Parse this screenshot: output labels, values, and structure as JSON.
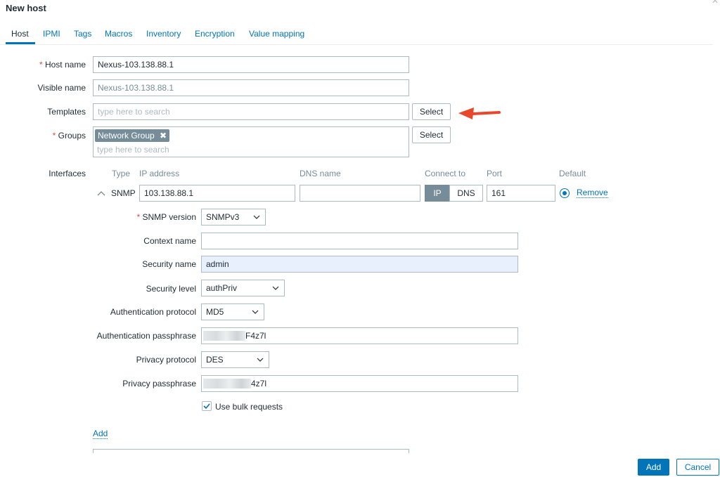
{
  "dialog": {
    "title": "New host"
  },
  "tabs": [
    "Host",
    "IPMI",
    "Tags",
    "Macros",
    "Inventory",
    "Encryption",
    "Value mapping"
  ],
  "form": {
    "host_name": {
      "label": "Host name",
      "required_mark": "*",
      "value": "Nexus-103.138.88.1"
    },
    "visible_name": {
      "label": "Visible name",
      "value": "Nexus-103.138.88.1"
    },
    "templates": {
      "label": "Templates",
      "placeholder": "type here to search",
      "select_label": "Select"
    },
    "groups": {
      "label": "Groups",
      "required_mark": "*",
      "chip": "Network Group",
      "placeholder": "type here to search",
      "select_label": "Select"
    },
    "interfaces": {
      "label": "Interfaces",
      "headers": {
        "type": "Type",
        "ip": "IP address",
        "dns": "DNS name",
        "connect_to": "Connect to",
        "port": "Port",
        "default": "Default"
      },
      "row": {
        "type": "SNMP",
        "ip": "103.138.88.1",
        "dns": "",
        "connect_ip": "IP",
        "connect_dns": "DNS",
        "port": "161",
        "remove": "Remove"
      },
      "add_link": "Add"
    },
    "snmp": {
      "version": {
        "label": "SNMP version",
        "required_mark": "*",
        "value": "SNMPv3"
      },
      "context_name": {
        "label": "Context name",
        "value": ""
      },
      "security_name": {
        "label": "Security name",
        "value": "admin"
      },
      "security_level": {
        "label": "Security level",
        "value": "authPriv"
      },
      "auth_protocol": {
        "label": "Authentication protocol",
        "value": "MD5"
      },
      "auth_passphrase": {
        "label": "Authentication passphrase",
        "visible_suffix": "F4z7l"
      },
      "priv_protocol": {
        "label": "Privacy protocol",
        "value": "DES"
      },
      "priv_passphrase": {
        "label": "Privacy passphrase",
        "visible_suffix": "4z7l"
      },
      "bulk": {
        "label": "Use bulk requests",
        "checked": true
      }
    }
  },
  "footer": {
    "add_label": "Add",
    "cancel_label": "Cancel"
  },
  "colors": {
    "accent": "#0275b8",
    "arrow": "#e8472b",
    "required": "#d64e4e",
    "chip": "#768d99"
  }
}
